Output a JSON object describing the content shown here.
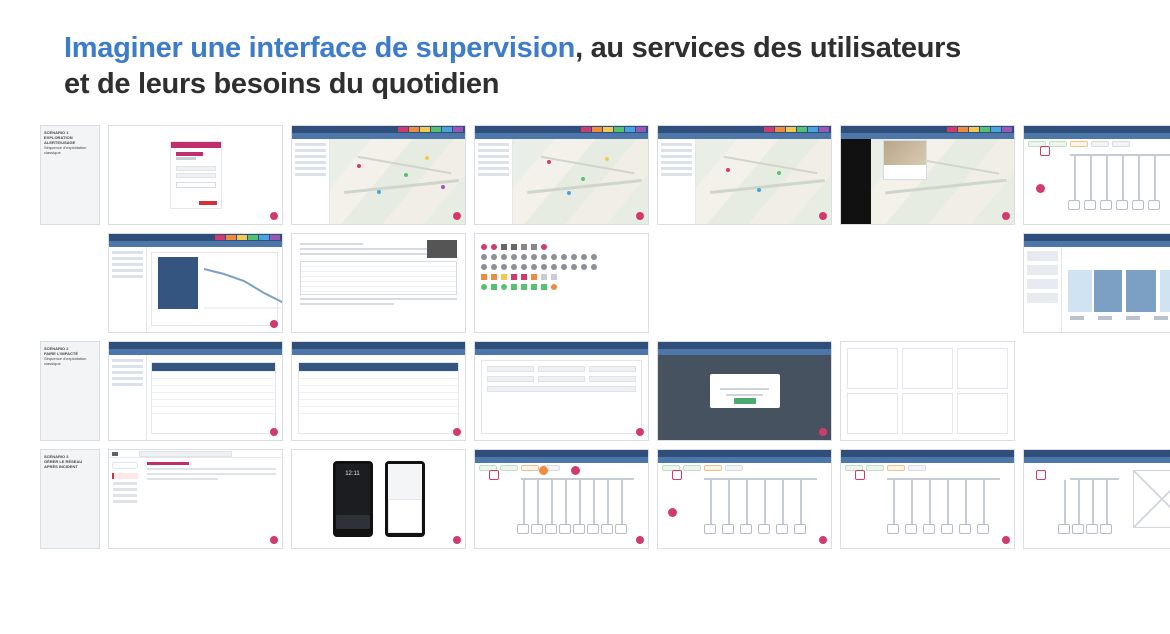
{
  "headline": {
    "emph": "Imaginer une interface de supervision",
    "rest": ", au services des utilisateurs et de leurs besoins du quotidien"
  },
  "app": {
    "brand_primary": "#2f4f7a",
    "brand_accent": "#c12f6a",
    "status_colors": [
      "#d23a6e",
      "#f08a3c",
      "#f2c94c",
      "#56c271",
      "#4aa3df",
      "#9b59b6"
    ]
  },
  "scenarios": {
    "s1": {
      "kicker": "SCÉNARIO 1",
      "title": "EXPLORATION ALERTE/USAGE",
      "subtitle": "Séquence d'exploitation classique"
    },
    "s2": {
      "kicker": "SCÉNARIO 2",
      "title": "FAIRE L'IMPACTÉ",
      "subtitle": "Séquence d'exploitation classique"
    },
    "s3": {
      "kicker": "SCÉNARIO 3",
      "title": "GÉRER LE RÉSEAU APRÈS INCIDENT"
    }
  },
  "login": {
    "title": "SUPERVISION",
    "product": "STEGO",
    "signin": "Se connecter"
  },
  "phones": {
    "time": "12:11"
  },
  "gallery": {
    "rows": [
      {
        "id": "r1",
        "items": [
          "section-s1",
          "login",
          "map",
          "map",
          "map",
          "map-with-photo",
          "synoptic-wide"
        ]
      },
      {
        "id": "r2",
        "items": [
          "spacer-section",
          "dashboard-chart",
          "doc-spec",
          "icon-palette",
          "spacer-3",
          "gantt",
          "gantt"
        ]
      },
      {
        "id": "r3",
        "items": [
          "section-s2",
          "table-list",
          "table-list",
          "form",
          "modal",
          "cards-grid",
          "spacer-1"
        ]
      },
      {
        "id": "r4",
        "items": [
          "section-s3",
          "mail",
          "phones",
          "synoptic",
          "synoptic",
          "synoptic",
          "synoptic-wire"
        ]
      }
    ]
  }
}
